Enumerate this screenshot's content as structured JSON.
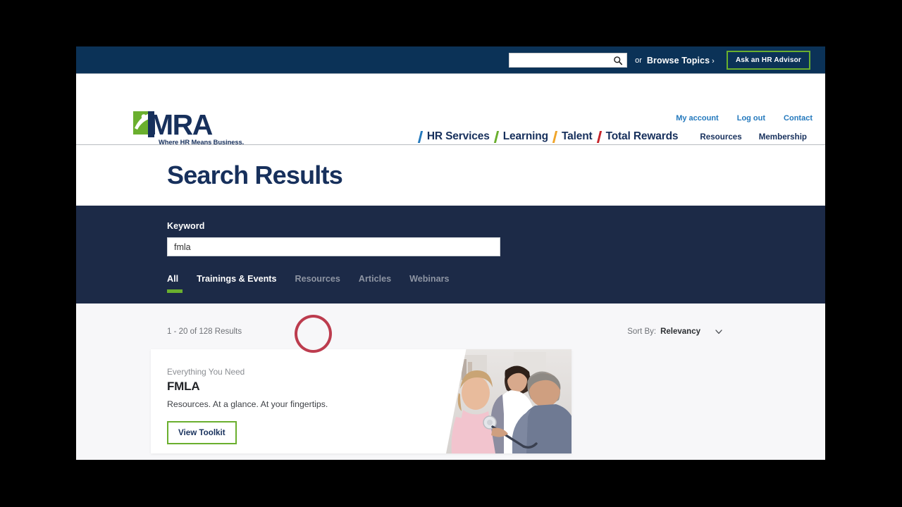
{
  "top_bar": {
    "search_placeholder": "",
    "search_value": "",
    "search_icon": "search-icon",
    "or_label": "or",
    "browse_topics_label": "Browse Topics",
    "browse_chevron": "›",
    "ask_advisor_label": "Ask an HR Advisor"
  },
  "brand": {
    "wordmark": "MRA",
    "tagline": "Where HR Means Business."
  },
  "utility_links": [
    {
      "label": "My account"
    },
    {
      "label": "Log out"
    },
    {
      "label": "Contact"
    }
  ],
  "nav": {
    "primary": [
      {
        "label": "HR Services",
        "accent": "#2479bd"
      },
      {
        "label": "Learning",
        "accent": "#6aaf2e"
      },
      {
        "label": "Talent",
        "accent": "#f0a52a"
      },
      {
        "label": "Total Rewards",
        "accent": "#c6252c"
      }
    ],
    "secondary": [
      {
        "label": "Resources"
      },
      {
        "label": "Membership"
      }
    ]
  },
  "page": {
    "title": "Search Results"
  },
  "search_panel": {
    "keyword_label": "Keyword",
    "keyword_value": "fmla",
    "keyword_placeholder": "",
    "tabs": [
      {
        "label": "All",
        "state": "active"
      },
      {
        "label": "Trainings & Events",
        "state": "hovered"
      },
      {
        "label": "Resources",
        "state": "default"
      },
      {
        "label": "Articles",
        "state": "default"
      },
      {
        "label": "Webinars",
        "state": "default"
      }
    ]
  },
  "results": {
    "count_text": "1 - 20 of 128 Results",
    "sort_label": "Sort By:",
    "sort_value": "Relevancy",
    "sort_icon": "chevron-down-icon",
    "items": [
      {
        "eyebrow": "Everything You Need",
        "title": "FMLA",
        "description": "Resources. At a glance. At your fingertips.",
        "cta_label": "View Toolkit",
        "image_alt": "doctor-examining-child-photo"
      }
    ]
  },
  "colors": {
    "top_bar_navy": "#0b3257",
    "panel_navy": "#1c2a47",
    "brand_navy": "#17305c",
    "accent_green": "#6aaf2e",
    "link_blue": "#2479bd",
    "annotation_red": "#b21b30",
    "results_bg": "#f7f7f9"
  }
}
